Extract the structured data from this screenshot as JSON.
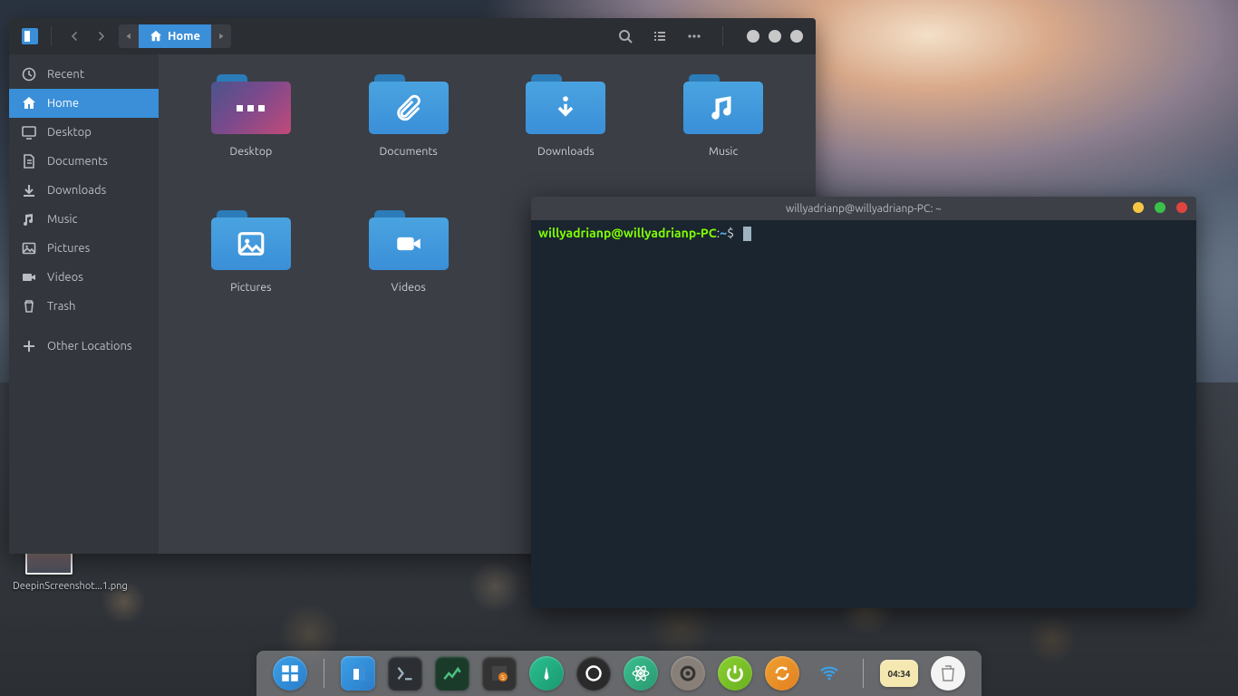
{
  "desktop": {
    "icons": [
      {
        "label": "DeepinScreenshot...1.png"
      }
    ]
  },
  "filemanager": {
    "breadcrumb": {
      "current": "Home"
    },
    "sidebar": [
      {
        "id": "recent",
        "label": "Recent",
        "active": false,
        "icon": "clock"
      },
      {
        "id": "home",
        "label": "Home",
        "active": true,
        "icon": "home"
      },
      {
        "id": "desktop",
        "label": "Desktop",
        "active": false,
        "icon": "monitor"
      },
      {
        "id": "documents",
        "label": "Documents",
        "active": false,
        "icon": "doc"
      },
      {
        "id": "downloads",
        "label": "Downloads",
        "active": false,
        "icon": "download"
      },
      {
        "id": "music",
        "label": "Music",
        "active": false,
        "icon": "music"
      },
      {
        "id": "pictures",
        "label": "Pictures",
        "active": false,
        "icon": "picture"
      },
      {
        "id": "videos",
        "label": "Videos",
        "active": false,
        "icon": "video"
      },
      {
        "id": "trash",
        "label": "Trash",
        "active": false,
        "icon": "trash"
      },
      {
        "id": "other",
        "label": "Other Locations",
        "active": false,
        "icon": "plus",
        "gap": true
      }
    ],
    "folders": [
      {
        "id": "desktop",
        "label": "Desktop",
        "icon": "desktop"
      },
      {
        "id": "documents",
        "label": "Documents",
        "icon": "clip"
      },
      {
        "id": "downloads",
        "label": "Downloads",
        "icon": "download"
      },
      {
        "id": "music",
        "label": "Music",
        "icon": "music"
      },
      {
        "id": "pictures",
        "label": "Pictures",
        "icon": "picture"
      },
      {
        "id": "videos",
        "label": "Videos",
        "icon": "video"
      }
    ]
  },
  "terminal": {
    "title": "willyadrianp@willyadrianp-PC: ~",
    "prompt_user": "willyadrianp@willyadrianp-PC",
    "prompt_sep": ":",
    "prompt_path": "~",
    "prompt_suffix": "$"
  },
  "dock": {
    "clock": "04:34",
    "items": [
      {
        "id": "launcher",
        "name": "launcher-icon"
      },
      {
        "id": "files",
        "name": "file-manager-icon"
      },
      {
        "id": "terminal",
        "name": "terminal-icon"
      },
      {
        "id": "monitor",
        "name": "system-monitor-icon"
      },
      {
        "id": "sublime",
        "name": "text-editor-icon"
      },
      {
        "id": "compass",
        "name": "browser-icon"
      },
      {
        "id": "music",
        "name": "music-player-icon"
      },
      {
        "id": "atom",
        "name": "atom-icon"
      },
      {
        "id": "settings",
        "name": "settings-icon"
      },
      {
        "id": "power",
        "name": "power-icon"
      },
      {
        "id": "updater",
        "name": "updater-icon"
      },
      {
        "id": "wifi",
        "name": "wifi-icon"
      }
    ]
  }
}
